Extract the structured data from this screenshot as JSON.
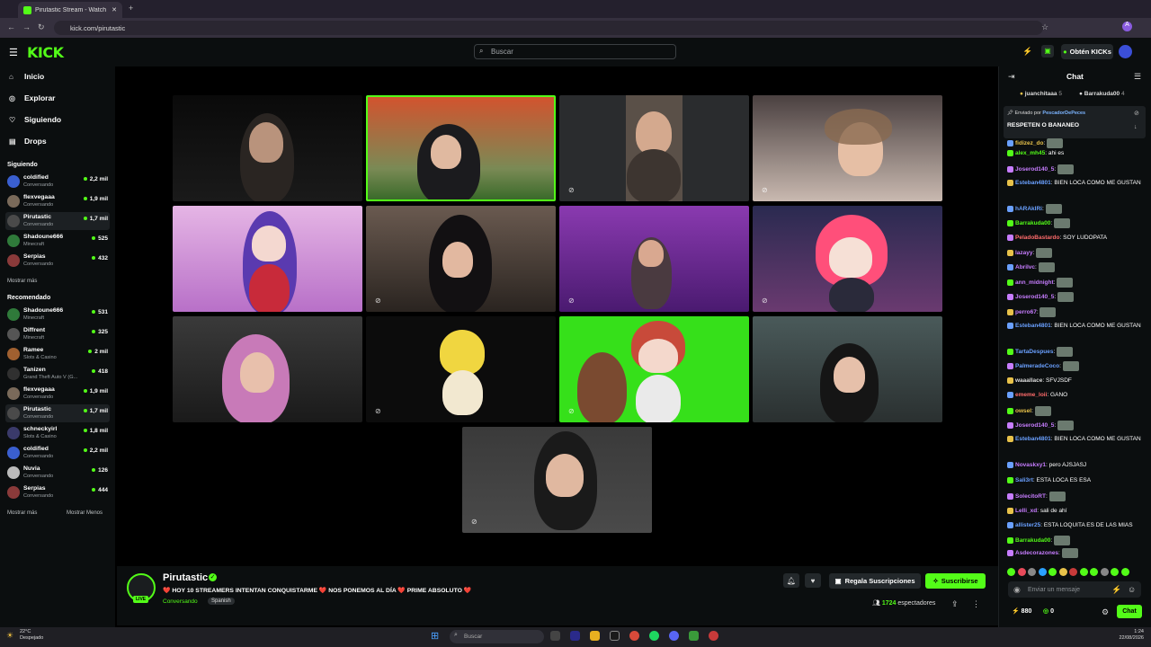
{
  "browser": {
    "tab_title": "Pirutastic Stream - Watch Li",
    "url": "kick.com/pirutastic"
  },
  "header": {
    "logo": "KICK",
    "search_placeholder": "Buscar",
    "kicks_button": "Obtén KICKs"
  },
  "sidebar": {
    "nav": [
      "Inicio",
      "Explorar",
      "Siguiendo",
      "Drops"
    ],
    "following_title": "Siguiendo",
    "following": [
      {
        "name": "coldified",
        "category": "Conversando",
        "viewers": "2,2 mil",
        "color": "#3a5fd0"
      },
      {
        "name": "flexvegaaa",
        "category": "Conversando",
        "viewers": "1,9 mil",
        "color": "#7a6a5a"
      },
      {
        "name": "Pirutastic",
        "category": "Conversando",
        "viewers": "1,7 mil",
        "color": "#4a4a4a"
      },
      {
        "name": "Shadoune666",
        "category": "Minecraft",
        "viewers": "525",
        "color": "#2f7a3a"
      },
      {
        "name": "Serpias",
        "category": "Conversando",
        "viewers": "432",
        "color": "#8a3a3a"
      }
    ],
    "show_more_1": "Mostrar más",
    "recommended_title": "Recomendado",
    "recommended": [
      {
        "name": "Shadoune666",
        "category": "Minecraft",
        "viewers": "531",
        "color": "#2f7a3a"
      },
      {
        "name": "Diffrent",
        "category": "Minecraft",
        "viewers": "325",
        "color": "#555"
      },
      {
        "name": "Ramee",
        "category": "Slots & Casino",
        "viewers": "2 mil",
        "color": "#a06030"
      },
      {
        "name": "Tanizen",
        "category": "Grand Theft Auto V (G...",
        "viewers": "418",
        "color": "#303030"
      },
      {
        "name": "flexvegaaa",
        "category": "Conversando",
        "viewers": "1,9 mil",
        "color": "#7a6a5a"
      },
      {
        "name": "Pirutastic",
        "category": "Conversando",
        "viewers": "1,7 mil",
        "color": "#4a4a4a"
      },
      {
        "name": "schneckyirl",
        "category": "Slots & Casino",
        "viewers": "1,8 mil",
        "color": "#3a3a6a"
      },
      {
        "name": "coldified",
        "category": "Conversando",
        "viewers": "2,2 mil",
        "color": "#3a5fd0"
      },
      {
        "name": "Nuvia",
        "category": "Conversando",
        "viewers": "126",
        "color": "#bbb"
      },
      {
        "name": "Serpias",
        "category": "Conversando",
        "viewers": "444",
        "color": "#8a3a3a"
      }
    ],
    "show_more_2": "Mostrar más",
    "show_less": "Mostrar Menos"
  },
  "stream": {
    "streamer": "Pirutastic",
    "live_badge": "LIVE",
    "title": "❤️ HOY 10 STREAMERS INTENTAN CONQUISTARME ❤️ NOS PONEMOS AL DÍA ❤️ PRIME ABSOLUTO ❤️",
    "category": "Conversando",
    "language": "Spanish",
    "gift_button": "Regala Suscripciones",
    "subscribe_button": "Suscribirse",
    "viewer_count": "1724",
    "viewer_label": "espectadores"
  },
  "chat": {
    "title": "Chat",
    "top_gifters": [
      {
        "name": "juanchitaaa",
        "count": "5"
      },
      {
        "name": "Barrakuda00",
        "count": "4"
      }
    ],
    "pinned_by_label": "Enviado por",
    "pinned_by": "PescadorDePeces",
    "pinned_message": "RESPETEN O BANANEO",
    "messages": [
      {
        "user": "fidizez_do",
        "text": "",
        "color": "#e8c24a"
      },
      {
        "user": "alex_mh45",
        "text": "ahi es",
        "color": "#53fc18"
      },
      {
        "user": "Joserod140_5",
        "text": "",
        "color": "#c77dff"
      },
      {
        "user": "Esteban4801",
        "text": "BIEN LOCA COMO ME GUSTAN",
        "color": "#6aa0ff"
      },
      {
        "user": "hARAkIRi",
        "text": "",
        "color": "#6aa0ff"
      },
      {
        "user": "Barrakuda00",
        "text": "",
        "color": "#53fc18"
      },
      {
        "user": "PeladoBastardo",
        "text": "SOY LUDOPATA",
        "color": "#ff6b6b"
      },
      {
        "user": "lazayy",
        "text": "",
        "color": "#c77dff"
      },
      {
        "user": "Abrilvc",
        "text": "",
        "color": "#c77dff"
      },
      {
        "user": "ann_midnight",
        "text": "",
        "color": "#c77dff"
      },
      {
        "user": "Joserod140_5",
        "text": "",
        "color": "#c77dff"
      },
      {
        "user": "perro67",
        "text": "",
        "color": "#c77dff"
      },
      {
        "user": "Esteban4801",
        "text": "BIEN LOCA COMO ME GUSTAN",
        "color": "#6aa0ff"
      },
      {
        "user": "TartaDespues",
        "text": "",
        "color": "#6aa0ff"
      },
      {
        "user": "PalmeradeCoco",
        "text": "",
        "color": "#6aa0ff"
      },
      {
        "user": "waaallace",
        "text": "SFVJSDF",
        "color": "#ddd"
      },
      {
        "user": "ememe_loii",
        "text": "GANO",
        "color": "#ff6b6b"
      },
      {
        "user": "owsel",
        "text": "",
        "color": "#e8c24a"
      },
      {
        "user": "Joserod140_5",
        "text": "",
        "color": "#c77dff"
      },
      {
        "user": "Esteban4801",
        "text": "BIEN LOCA COMO ME GUSTAN",
        "color": "#6aa0ff"
      },
      {
        "user": "Novaskxy1",
        "text": "pero AJSJASJ",
        "color": "#c77dff"
      },
      {
        "user": "Sali3rt",
        "text": "ESTA LOCA ES ESA",
        "color": "#6aa0ff"
      },
      {
        "user": "SolecitoRT",
        "text": "",
        "color": "#c77dff"
      },
      {
        "user": "Lelli_xd",
        "text": "sali de ahí",
        "color": "#c77dff"
      },
      {
        "user": "allister25",
        "text": "ESTA LOQUITA ES DE LAS MIAS",
        "color": "#6aa0ff"
      },
      {
        "user": "Barrakuda00",
        "text": "",
        "color": "#53fc18"
      },
      {
        "user": "Asdecorazones",
        "text": "",
        "color": "#c77dff"
      }
    ],
    "input_placeholder": "Enviar un mensaje",
    "points": "880",
    "points2": "0",
    "chat_button": "Chat"
  },
  "taskbar": {
    "temp": "22°C",
    "weather": "Despejado",
    "search_placeholder": "Buscar",
    "time": "1:24",
    "date": "22/08/2026"
  },
  "colors": {
    "accent": "#53fc18",
    "bg": "#0b0e0f"
  }
}
